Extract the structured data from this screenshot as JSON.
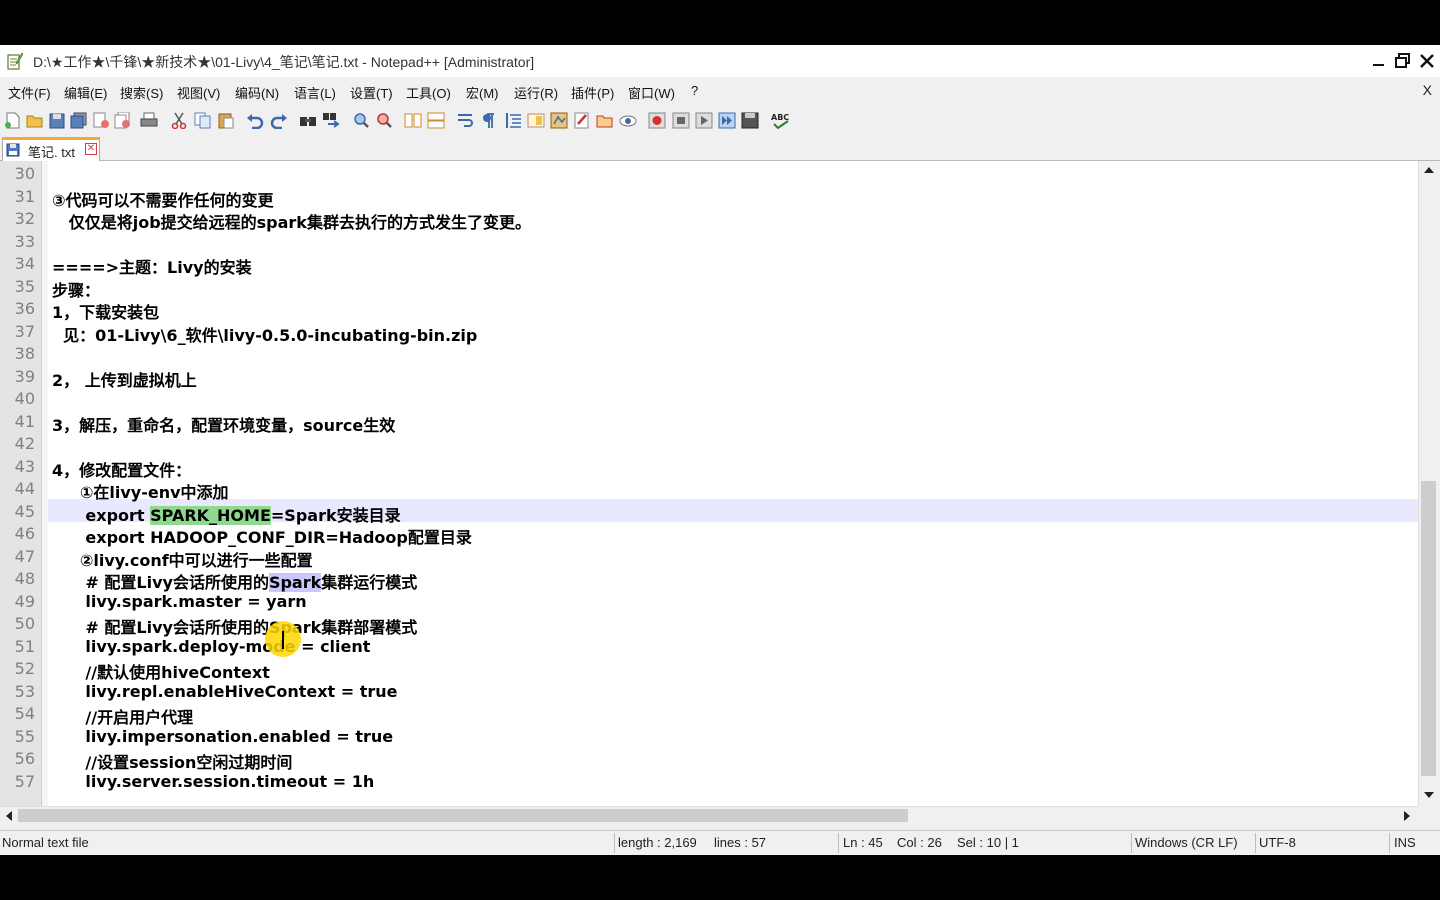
{
  "window": {
    "title": "D:\\★工作★\\千锋\\★新技术★\\01-Livy\\4_笔记\\笔记.txt - Notepad++ [Administrator]"
  },
  "menu": {
    "items": [
      "文件(F)",
      "编辑(E)",
      "搜索(S)",
      "视图(V)",
      "编码(N)",
      "语言(L)",
      "设置(T)",
      "工具(O)",
      "宏(M)",
      "运行(R)",
      "插件(P)",
      "窗口(W)",
      "?"
    ],
    "close_label": "X"
  },
  "toolbar": {
    "icons": [
      "new-file-icon",
      "open-file-icon",
      "save-icon",
      "save-all-icon",
      "close-icon",
      "close-all-icon",
      "print-icon",
      "cut-icon",
      "copy-icon",
      "paste-icon",
      "undo-icon",
      "redo-icon",
      "find-icon",
      "replace-icon",
      "zoom-in-icon",
      "zoom-out-icon",
      "sync-vertical-icon",
      "sync-horizontal-icon",
      "word-wrap-icon",
      "show-all-chars-icon",
      "indent-guide-icon",
      "doc-map-icon",
      "function-list-icon",
      "folder-workspace-icon",
      "doc-switcher-icon",
      "monitoring-icon",
      "record-macro-icon",
      "stop-record-icon",
      "play-macro-icon",
      "run-macro-multiple-icon",
      "save-macro-icon",
      "spell-check-icon"
    ]
  },
  "tab": {
    "label": "笔记. txt"
  },
  "editor": {
    "lines": [
      {
        "num": "30",
        "text": ""
      },
      {
        "num": "31",
        "text": "③代码可以不需要作任何的变更"
      },
      {
        "num": "32",
        "text": "   仅仅是将job提交给远程的spark集群去执行的方式发生了变更。"
      },
      {
        "num": "33",
        "text": ""
      },
      {
        "num": "34",
        "text": "====>主题：Livy的安装"
      },
      {
        "num": "35",
        "text": "步骤："
      },
      {
        "num": "36",
        "text": "1，下载安装包"
      },
      {
        "num": "37",
        "text": "  见：01-Livy\\6_软件\\livy-0.5.0-incubating-bin.zip"
      },
      {
        "num": "38",
        "text": ""
      },
      {
        "num": "39",
        "text": "2， 上传到虚拟机上"
      },
      {
        "num": "40",
        "text": ""
      },
      {
        "num": "41",
        "text": "3，解压，重命名，配置环境变量，source生效"
      },
      {
        "num": "42",
        "text": ""
      },
      {
        "num": "43",
        "text": "4，修改配置文件："
      },
      {
        "num": "44",
        "text": "     ①在livy-env中添加"
      },
      {
        "num": "45",
        "pre": "      export ",
        "sel": "SPARK_HOME",
        "post": "=Spark安装目录"
      },
      {
        "num": "46",
        "text": "      export HADOOP_CONF_DIR=Hadoop配置目录"
      },
      {
        "num": "47",
        "text": "     ②livy.conf中可以进行一些配置"
      },
      {
        "num": "48",
        "pre": "      # 配置Livy会话所使用的",
        "hl": "Spark",
        "post": "集群运行模式"
      },
      {
        "num": "49",
        "text": "      livy.spark.master = yarn"
      },
      {
        "num": "50",
        "text": "      # 配置Livy会话所使用的Spark集群部署模式"
      },
      {
        "num": "51",
        "text": "      livy.spark.deploy-mode = client"
      },
      {
        "num": "52",
        "text": "      //默认使用hiveContext"
      },
      {
        "num": "53",
        "text": "      livy.repl.enableHiveContext = true"
      },
      {
        "num": "54",
        "text": "      //开启用户代理"
      },
      {
        "num": "55",
        "text": "      livy.impersonation.enabled = true"
      },
      {
        "num": "56",
        "text": "      //设置session空闲过期时间"
      },
      {
        "num": "57",
        "text": "      livy.server.session.timeout = 1h"
      }
    ]
  },
  "statusbar": {
    "file_type": "Normal text file",
    "length": "length : 2,169",
    "lines": "lines : 57",
    "ln": "Ln : 45",
    "col": "Col : 26",
    "sel": "Sel : 10 | 1",
    "eol": "Windows (CR LF)",
    "encoding": "UTF-8",
    "mode": "INS"
  },
  "colors": {
    "selection": "#8fd98f",
    "current_line": "#e8e8ff",
    "tab_accent": "#f6a935",
    "pointer_highlight": "#ffd700"
  }
}
